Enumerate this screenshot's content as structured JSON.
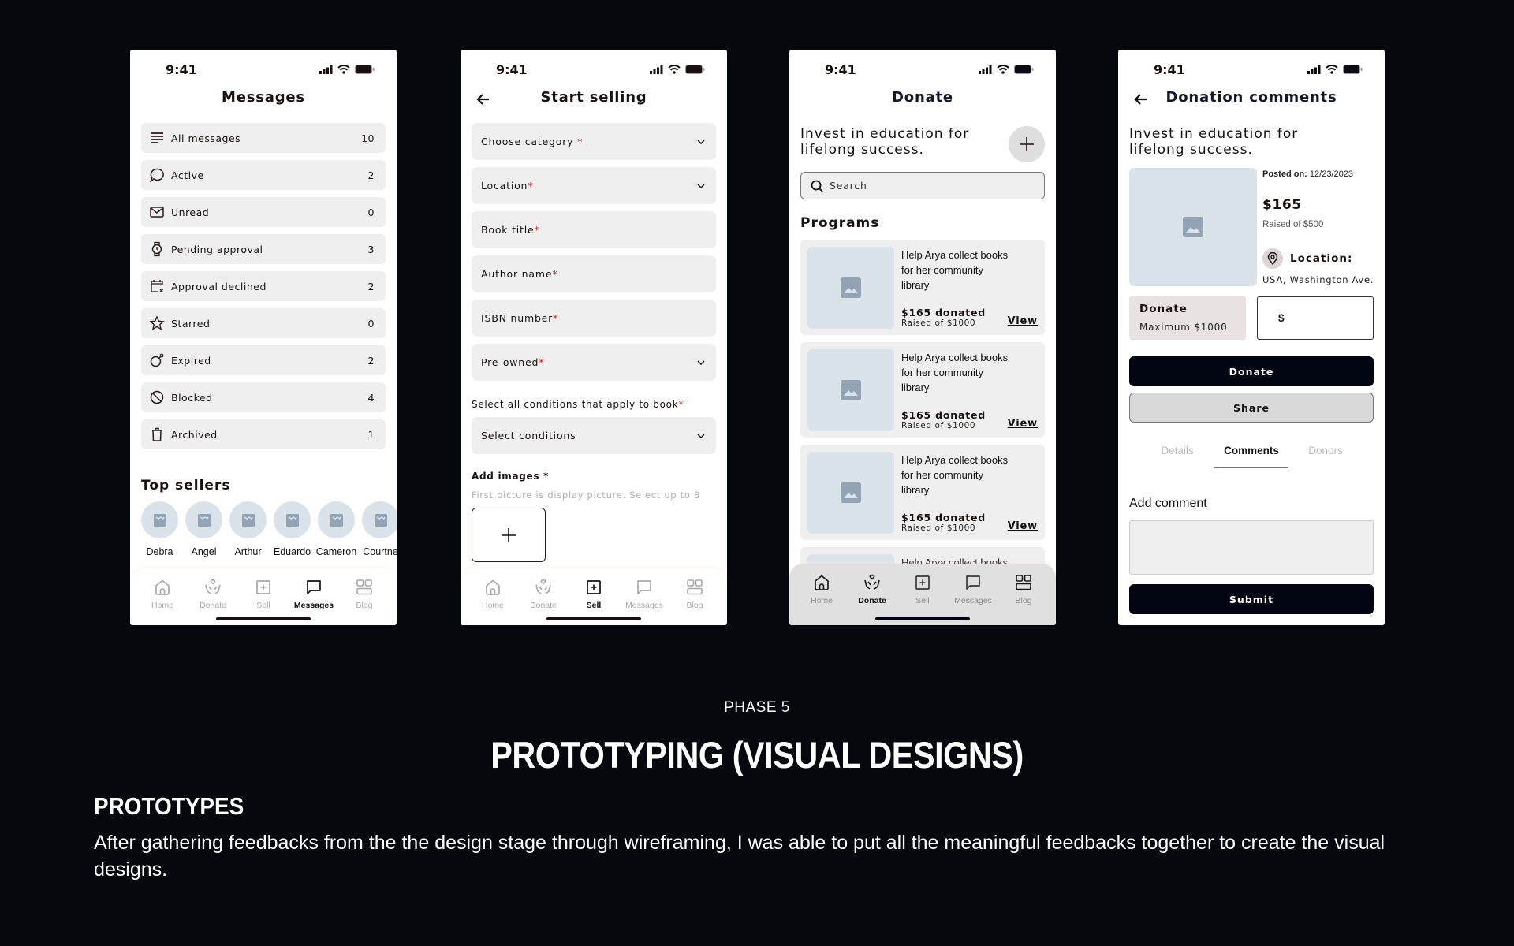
{
  "status_time": "9:41",
  "messages_screen": {
    "title": "Messages",
    "items": [
      {
        "label": "All messages",
        "count": "10",
        "icon": "list-icon"
      },
      {
        "label": "Active",
        "count": "2",
        "icon": "chat-bubble-icon"
      },
      {
        "label": "Unread",
        "count": "0",
        "icon": "envelope-icon"
      },
      {
        "label": "Pending approval",
        "count": "3",
        "icon": "watch-icon"
      },
      {
        "label": "Approval declined",
        "count": "2",
        "icon": "calendar-x-icon"
      },
      {
        "label": "Starred",
        "count": "0",
        "icon": "star-icon"
      },
      {
        "label": "Expired",
        "count": "2",
        "icon": "bomb-icon"
      },
      {
        "label": "Blocked",
        "count": "4",
        "icon": "blocked-icon"
      },
      {
        "label": "Archived",
        "count": "1",
        "icon": "trash-icon"
      }
    ],
    "top_sellers_title": "Top sellers",
    "sellers": [
      "Debra",
      "Angel",
      "Arthur",
      "Eduardo",
      "Cameron",
      "Courtne"
    ],
    "active_tab": "Messages"
  },
  "sell_screen": {
    "title": "Start selling",
    "fields": [
      {
        "label": "Choose category ",
        "required": "*",
        "dropdown": true
      },
      {
        "label": "Location",
        "required": "*",
        "dropdown": true
      },
      {
        "label": "Book title",
        "required": "*",
        "dropdown": false
      },
      {
        "label": "Author name",
        "required": "*",
        "dropdown": false
      },
      {
        "label": "ISBN number",
        "required": "*",
        "dropdown": false
      },
      {
        "label": "Pre-owned",
        "required": "*",
        "dropdown": true
      }
    ],
    "conditions_label": "Select all conditions that apply to book",
    "conditions_required": "*",
    "conditions_select": "Select conditions",
    "add_images_label": "Add images *",
    "add_images_hint": "First picture is display picture. Select up to 3",
    "active_tab": "Sell"
  },
  "donate_screen": {
    "title": "Donate",
    "tagline_line1": "Invest in education for",
    "tagline_line2": "lifelong success.",
    "search_placeholder": "Search",
    "programs_title": "Programs",
    "programs": [
      {
        "title": "Help Arya collect books for her community library",
        "donated": "$165 donated",
        "raised": "Raised of $1000",
        "view": "View"
      },
      {
        "title": "Help Arya collect books for her community library",
        "donated": "$165 donated",
        "raised": "Raised of $1000",
        "view": "View"
      },
      {
        "title": "Help Arya collect books for her community library",
        "donated": "$165 donated",
        "raised": "Raised of $1000",
        "view": "View"
      },
      {
        "title": "Help Arya collect books for",
        "donated": "",
        "raised": "",
        "view": ""
      }
    ],
    "active_tab": "Donate"
  },
  "comments_screen": {
    "title": "Donation comments",
    "tagline_line1": "Invest in education for",
    "tagline_line2": "lifelong success.",
    "posted_label": "Posted on:",
    "posted_date": "12/23/2023",
    "amount": "$165",
    "raised": "Raised of $500",
    "location_label": "Location:",
    "location_value": "USA, Washington Ave.",
    "donate_card_title": "Donate",
    "donate_card_sub": "Maximum $1000",
    "currency": "$",
    "donate_button": "Donate",
    "share_button": "Share",
    "tabs": [
      "Details",
      "Comments",
      "Donors"
    ],
    "active_tab": "Comments",
    "add_comment_label": "Add comment",
    "submit_button": "Submit"
  },
  "tabbar": [
    "Home",
    "Donate",
    "Sell",
    "Messages",
    "Blog"
  ],
  "footer": {
    "phase": "PHASE 5",
    "title": "PROTOTYPING (VISUAL DESIGNS)",
    "subtitle": "PROTOTYPES",
    "paragraph": "After gathering feedbacks from the the design stage through wireframing, I was able to put all the meaningful feedbacks together to create the  visual designs."
  }
}
